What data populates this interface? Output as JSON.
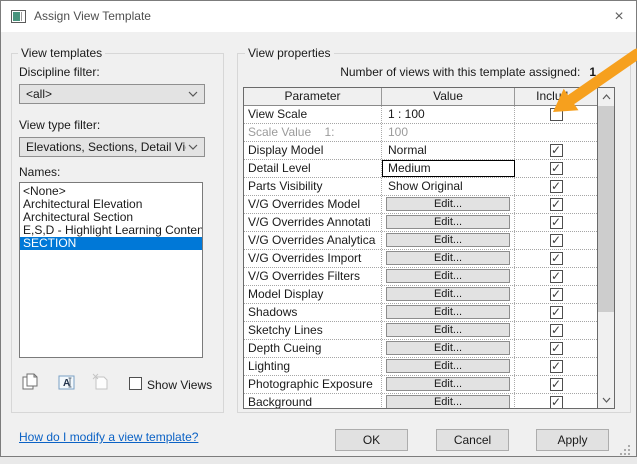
{
  "window": {
    "title": "Assign View Template"
  },
  "icons": {
    "close": "×",
    "check": "✓"
  },
  "colors": {
    "selection": "#0078d7",
    "link": "#0b62c5",
    "arrow": "#F6A01E",
    "dialog_bg": "#f0f0f0"
  },
  "view_templates": {
    "group_title": "View templates",
    "discipline_filter_label": "Discipline filter:",
    "discipline_filter_value": "<all>",
    "view_type_filter_label": "View type filter:",
    "view_type_filter_value": "Elevations, Sections, Detail Views",
    "names_label": "Names:",
    "names": [
      "<None>",
      "Architectural Elevation",
      "Architectural Section",
      "E,S,D - Highlight Learning Content",
      "SECTION"
    ],
    "selected_name": "SECTION",
    "show_views_label": "Show Views"
  },
  "view_properties": {
    "group_title": "View properties",
    "assigned_label": "Number of views with this template assigned:",
    "assigned_count": "1",
    "table": {
      "headers": [
        "Parameter",
        "Value",
        "Include"
      ],
      "rows": [
        {
          "parameter": "View Scale",
          "value": "1 : 100",
          "value_type": "text",
          "include": "unchecked"
        },
        {
          "parameter": "Scale Value    1:",
          "value": "100",
          "value_type": "text",
          "include": "none",
          "disabled": true
        },
        {
          "parameter": "Display Model",
          "value": "Normal",
          "value_type": "text",
          "include": "checked"
        },
        {
          "parameter": "Detail Level",
          "value": "Medium",
          "value_type": "text",
          "include": "checked",
          "focused": true
        },
        {
          "parameter": "Parts Visibility",
          "value": "Show Original",
          "value_type": "text",
          "include": "checked"
        },
        {
          "parameter": "V/G Overrides Model",
          "value": "Edit...",
          "value_type": "button",
          "include": "checked"
        },
        {
          "parameter": "V/G Overrides Annotati",
          "value": "Edit...",
          "value_type": "button",
          "include": "checked"
        },
        {
          "parameter": "V/G Overrides Analytica",
          "value": "Edit...",
          "value_type": "button",
          "include": "checked"
        },
        {
          "parameter": "V/G Overrides Import",
          "value": "Edit...",
          "value_type": "button",
          "include": "checked"
        },
        {
          "parameter": "V/G Overrides Filters",
          "value": "Edit...",
          "value_type": "button",
          "include": "checked"
        },
        {
          "parameter": "Model Display",
          "value": "Edit...",
          "value_type": "button",
          "include": "checked"
        },
        {
          "parameter": "Shadows",
          "value": "Edit...",
          "value_type": "button",
          "include": "checked"
        },
        {
          "parameter": "Sketchy Lines",
          "value": "Edit...",
          "value_type": "button",
          "include": "checked"
        },
        {
          "parameter": "Depth Cueing",
          "value": "Edit...",
          "value_type": "button",
          "include": "checked"
        },
        {
          "parameter": "Lighting",
          "value": "Edit...",
          "value_type": "button",
          "include": "checked"
        },
        {
          "parameter": "Photographic Exposure",
          "value": "Edit...",
          "value_type": "button",
          "include": "checked"
        },
        {
          "parameter": "Background",
          "value": "Edit...",
          "value_type": "button",
          "include": "checked"
        }
      ]
    }
  },
  "footer": {
    "help_link": "How do I modify a view template?",
    "ok": "OK",
    "cancel": "Cancel",
    "apply": "Apply"
  }
}
